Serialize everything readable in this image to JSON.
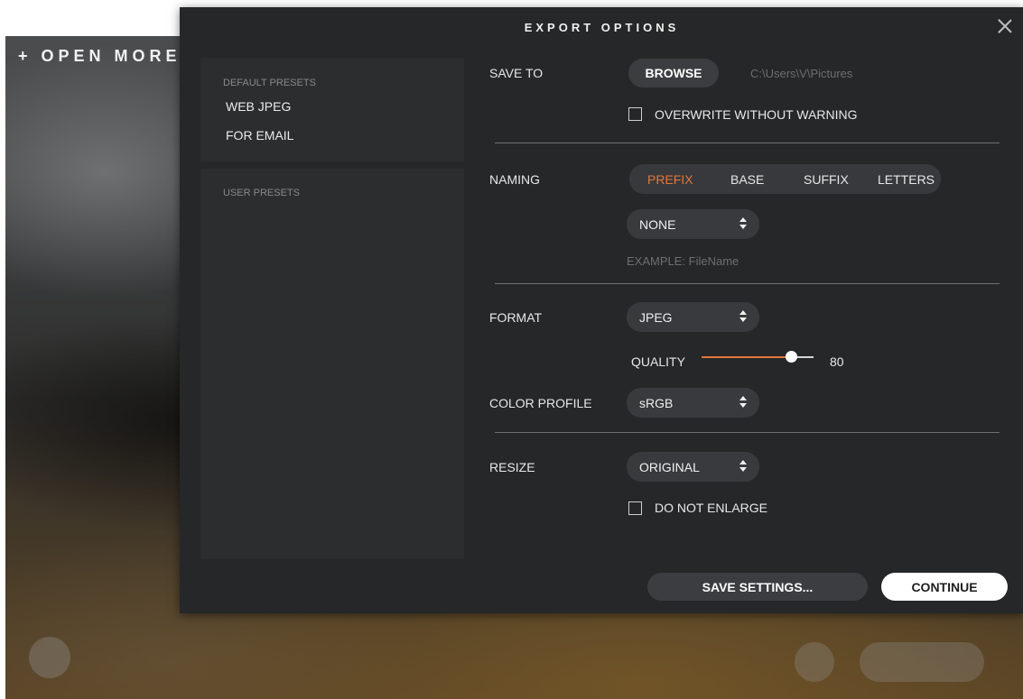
{
  "background": {
    "open_more_label": "+ OPEN MORE"
  },
  "dialog": {
    "title": "EXPORT OPTIONS",
    "close_icon": "close-icon"
  },
  "presets": {
    "default_header": "DEFAULT PRESETS",
    "default_items": [
      "WEB JPEG",
      "FOR EMAIL"
    ],
    "user_header": "USER PRESETS"
  },
  "save_to": {
    "label": "SAVE TO",
    "browse_label": "BROWSE",
    "path": "C:\\Users\\V\\Pictures",
    "overwrite_label": "OVERWRITE WITHOUT WARNING",
    "overwrite_checked": false
  },
  "naming": {
    "label": "NAMING",
    "tabs": [
      "PREFIX",
      "BASE",
      "SUFFIX",
      "LETTERS"
    ],
    "active_tab": "PREFIX",
    "prefix_value": "NONE",
    "example": "EXAMPLE: FileName"
  },
  "format": {
    "label": "FORMAT",
    "value": "JPEG",
    "quality_label": "QUALITY",
    "quality_value": "80",
    "quality_fraction": 0.8
  },
  "color_profile": {
    "label": "COLOR PROFILE",
    "value": "sRGB"
  },
  "resize": {
    "label": "RESIZE",
    "value": "ORIGINAL",
    "do_not_enlarge_label": "DO NOT ENLARGE",
    "do_not_enlarge_checked": false
  },
  "footer": {
    "save_settings_label": "SAVE SETTINGS...",
    "continue_label": "CONTINUE"
  },
  "colors": {
    "accent": "#e0773b",
    "dialog_bg": "#262729"
  }
}
